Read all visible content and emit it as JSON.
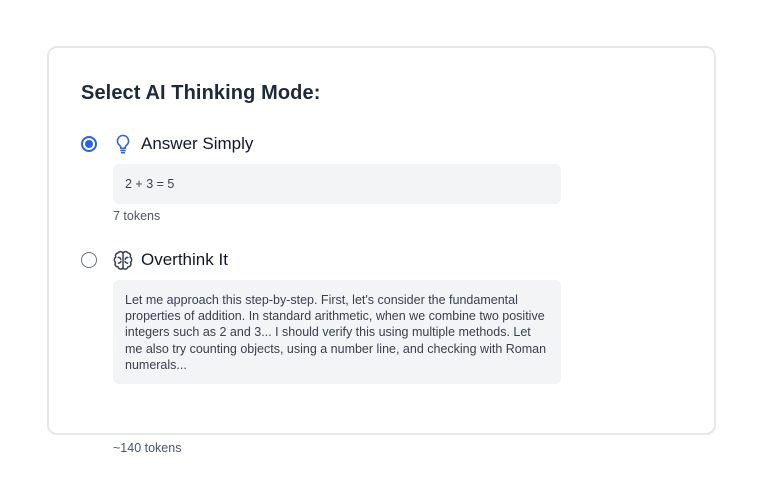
{
  "heading": "Select AI Thinking Mode:",
  "options": [
    {
      "label": "Answer Simply",
      "icon": "lightbulb-icon",
      "selected": true,
      "response": "2 + 3 = 5",
      "tokens": "7 tokens"
    },
    {
      "label": "Overthink It",
      "icon": "brain-icon",
      "selected": false,
      "response": "Let me approach this step-by-step. First, let's consider the fundamental properties of addition. In standard arithmetic, when we combine two positive integers such as 2 and 3... I should verify this using multiple methods. Let me also try counting objects, using a number line, and checking with Roman numerals...",
      "tokens": "~140 tokens"
    }
  ],
  "colors": {
    "accent": "#2563eb",
    "response_bg": "#f3f4f6",
    "border": "#e5e7eb"
  }
}
